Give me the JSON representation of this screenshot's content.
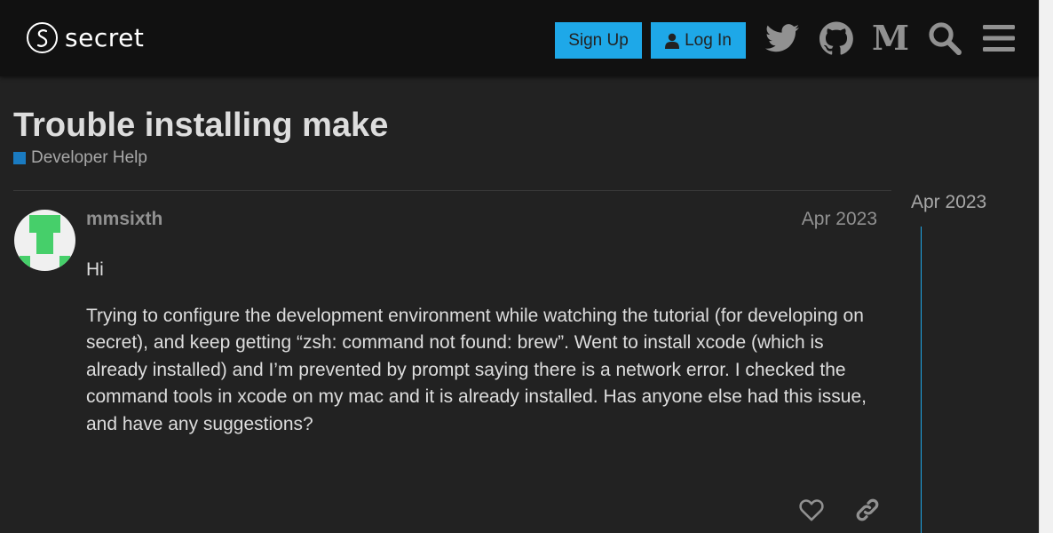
{
  "header": {
    "logo_text": "secret",
    "signup_label": "Sign Up",
    "login_label": "Log In"
  },
  "icons": {
    "twitter": "twitter-icon",
    "github": "github-icon",
    "medium": "medium-icon",
    "search": "search-icon",
    "menu": "hamburger-menu-icon"
  },
  "topic": {
    "title": "Trouble installing make",
    "category": "Developer Help",
    "category_color": "#1a7bc1"
  },
  "post": {
    "username": "mmsixth",
    "date": "Apr 2023",
    "paragraphs": [
      "Hi",
      "Trying to configure the development environment while watching the tutorial (for developing on secret), and keep getting “zsh: command not found: brew”. Went to install xcode (which is already installed) and I’m prevented by prompt saying there is a network error. I checked the command tools in xcode on my mac and it is already installed. Has anyone else had this issue, and have any suggestions?"
    ]
  },
  "timeline": {
    "date": "Apr 2023"
  },
  "colors": {
    "accent": "#1ea8e8",
    "header_bg": "#111111",
    "page_bg": "#222222",
    "avatar_green": "#46cf6a"
  }
}
